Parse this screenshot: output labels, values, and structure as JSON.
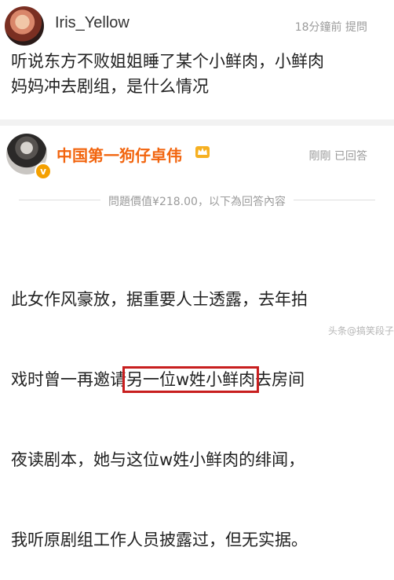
{
  "question": {
    "username": "Iris_Yellow",
    "time": "18分鐘前",
    "action": "提問",
    "text_line1": "听说东方不败姐姐睡了某个小鲜肉，小鲜肉",
    "text_line2": "妈妈冲去剧组，是什么情况"
  },
  "answer": {
    "username": "中国第一狗仔卓伟",
    "time": "剛剛",
    "status": "已回答",
    "price_text": "問題價值¥218.00，以下為回答內容",
    "line1": "此女作风豪放，据重要人士透露，去年拍",
    "line2_pre": "戏时曾一再邀请",
    "line2_highlight": "另一位w姓小鲜肉",
    "line2_post": "去房间",
    "line3": "夜读剧本，她与这位w姓小鲜肉的绯闻，",
    "line4": "我听原剧组工作人员披露过，但无实据。"
  },
  "watermark": "头条@搞笑段子",
  "colors": {
    "name_accent": "#f2650f",
    "highlight_border": "#c81e1e",
    "meta_gray": "#9b9b9b"
  },
  "icons": {
    "verified": "v-badge-icon",
    "crown": "crown-icon"
  }
}
